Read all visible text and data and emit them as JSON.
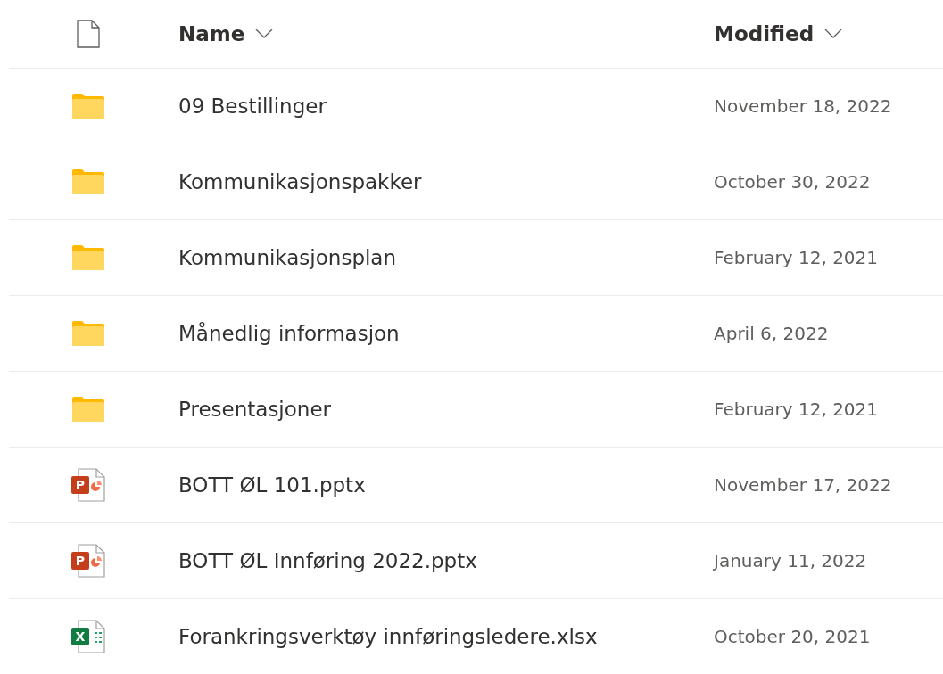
{
  "columns": [
    {
      "label": "Name"
    },
    {
      "label": "Modified"
    }
  ],
  "rows": [
    {
      "kind": "folder",
      "name": "09 Bestillinger",
      "modified": "November 18, 2022"
    },
    {
      "kind": "folder",
      "name": "Kommunikasjonspakker",
      "modified": "October 30, 2022"
    },
    {
      "kind": "folder",
      "name": "Kommunikasjonsplan",
      "modified": "February 12, 2021"
    },
    {
      "kind": "folder",
      "name": "Månedlig informasjon",
      "modified": "April 6, 2022"
    },
    {
      "kind": "folder",
      "name": "Presentasjoner",
      "modified": "February 12, 2021"
    },
    {
      "kind": "pptx",
      "badge": "P",
      "name": "BOTT ØL 101.pptx",
      "modified": "November 17, 2022"
    },
    {
      "kind": "pptx",
      "badge": "P",
      "name": "BOTT ØL Innføring 2022.pptx",
      "modified": "January 11, 2022"
    },
    {
      "kind": "xlsx",
      "badge": "X",
      "name": "Forankringsverktøy innføringsledere.xlsx",
      "modified": "October 20, 2021"
    }
  ]
}
